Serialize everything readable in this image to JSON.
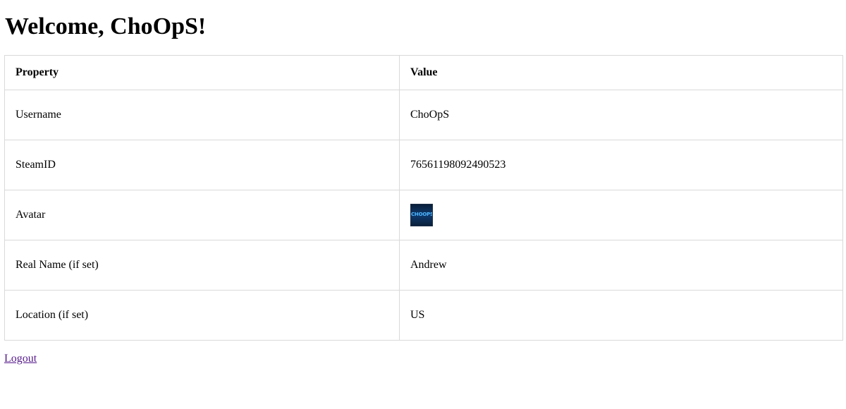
{
  "heading": "Welcome, ChoOpS!",
  "table": {
    "headers": [
      "Property",
      "Value"
    ],
    "rows": [
      {
        "property": "Username",
        "value": "ChoOpS"
      },
      {
        "property": "SteamID",
        "value": "76561198092490523"
      },
      {
        "property": "Avatar",
        "value_image": "avatar-image",
        "avatar_text": "CHOOPS"
      },
      {
        "property": "Real Name (if set)",
        "value": "Andrew"
      },
      {
        "property": "Location (if set)",
        "value": "US"
      }
    ]
  },
  "logout_label": "Logout",
  "colors": {
    "text": "#000000",
    "border": "#d9d9d9",
    "visited_link": "#551a8b",
    "avatar_bg": "#0e3a6e",
    "avatar_text": "#4fb6ff"
  }
}
